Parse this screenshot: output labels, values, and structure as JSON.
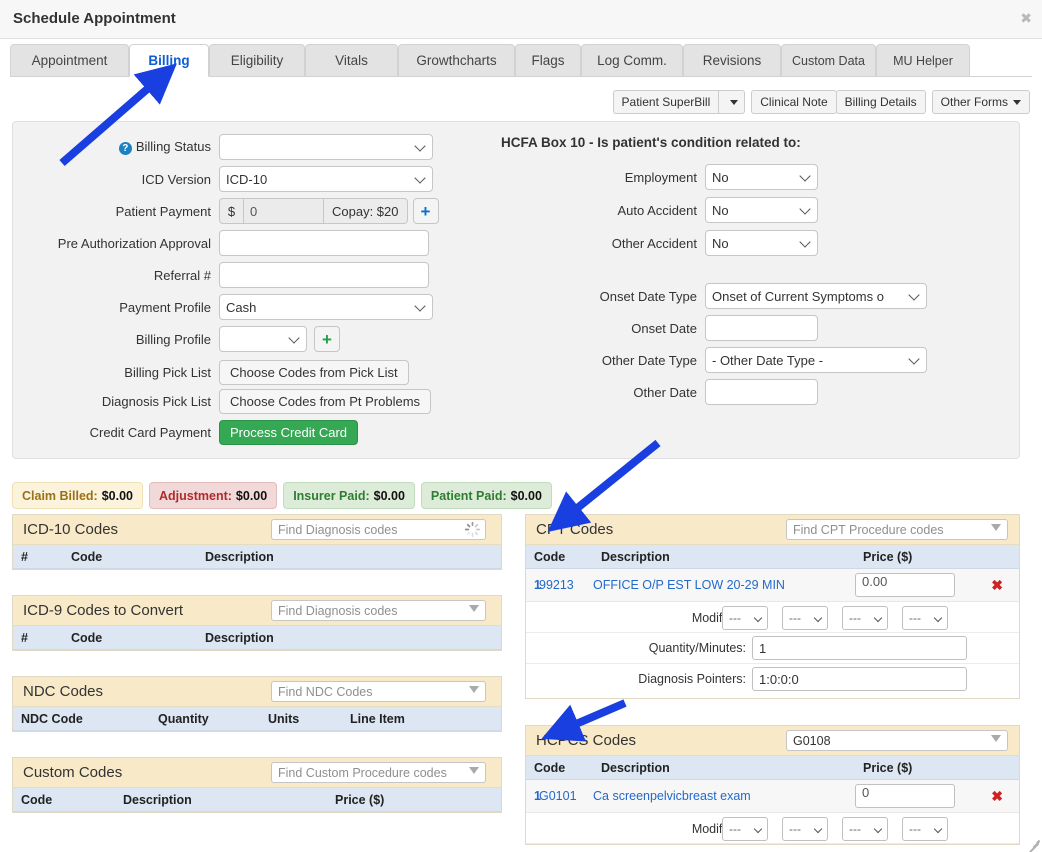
{
  "window": {
    "title": "Schedule Appointment",
    "close_label": "✖"
  },
  "tabs": [
    {
      "label": "Appointment",
      "active": false
    },
    {
      "label": "Billing",
      "active": true
    },
    {
      "label": "Eligibility",
      "active": false
    },
    {
      "label": "Vitals",
      "active": false
    },
    {
      "label": "Growthcharts",
      "active": false
    },
    {
      "label": "Flags",
      "active": false
    },
    {
      "label": "Log Comm.",
      "active": false
    },
    {
      "label": "Revisions",
      "active": false
    },
    {
      "label": "Custom Data",
      "active": false
    },
    {
      "label": "MU Helper",
      "active": false
    }
  ],
  "form_buttons": {
    "patient_superbill": "Patient SuperBill",
    "superbill_caret": "▼",
    "clinical_note": "Clinical Note",
    "billing_details": "Billing Details",
    "other_forms": "Other Forms"
  },
  "billing_form": {
    "help_icon_char": "?",
    "billing_status_label": "Billing Status",
    "billing_status_value": "",
    "icd_version_label": "ICD Version",
    "icd_version_value": "ICD-10",
    "patient_payment_label": "Patient Payment",
    "patient_payment_currency": "$",
    "patient_payment_value": "0",
    "copay_label": "Copay: $20",
    "add_payment_icon": "+",
    "pre_auth_label": "Pre Authorization Approval",
    "pre_auth_value": "",
    "referral_label": "Referral #",
    "referral_value": "",
    "payment_profile_label": "Payment Profile",
    "payment_profile_value": "Cash",
    "billing_profile_label": "Billing Profile",
    "billing_profile_value": "",
    "billing_profile_add_icon": "+",
    "billing_pick_list_label": "Billing Pick List",
    "billing_pick_list_button": "Choose Codes from Pick List",
    "diagnosis_pick_list_label": "Diagnosis Pick List",
    "diagnosis_pick_list_button": "Choose Codes from Pt Problems",
    "credit_card_label": "Credit Card Payment",
    "credit_card_button": "Process Credit Card"
  },
  "hcfa": {
    "title": "HCFA Box 10 - Is patient's condition related to:",
    "employment_label": "Employment",
    "employment_value": "No",
    "auto_accident_label": "Auto Accident",
    "auto_accident_value": "No",
    "other_accident_label": "Other Accident",
    "other_accident_value": "No",
    "onset_date_type_label": "Onset Date Type",
    "onset_date_type_value": "Onset of Current Symptoms o",
    "onset_date_label": "Onset Date",
    "onset_date_value": "",
    "other_date_type_label": "Other Date Type",
    "other_date_type_value": "- Other Date Type -",
    "other_date_label": "Other Date",
    "other_date_value": ""
  },
  "badges": [
    {
      "label": "Claim Billed:",
      "amount": "$0.00",
      "bg": "#fcf3dd",
      "border": "#f0e0b4",
      "fg": "#9a7116"
    },
    {
      "label": "Adjustment:",
      "amount": "$0.00",
      "bg": "#f2d9d9",
      "border": "#e4bcbc",
      "fg": "#b02b2b"
    },
    {
      "label": "Insurer Paid:",
      "amount": "$0.00",
      "bg": "#dcecd9",
      "border": "#c2dcbe",
      "fg": "#2f7d33"
    },
    {
      "label": "Patient Paid:",
      "amount": "$0.00",
      "bg": "#dcecd9",
      "border": "#c2dcbe",
      "fg": "#2f7d33"
    }
  ],
  "panels": {
    "icd10": {
      "title": "ICD-10 Codes",
      "search_placeholder": "Find Diagnosis codes",
      "columns": [
        "#",
        "Code",
        "Description"
      ],
      "rows": []
    },
    "icd9": {
      "title": "ICD-9 Codes to Convert",
      "search_placeholder": "Find Diagnosis codes",
      "columns": [
        "#",
        "Code",
        "Description"
      ],
      "rows": []
    },
    "ndc": {
      "title": "NDC Codes",
      "search_placeholder": "Find NDC Codes",
      "columns": [
        "NDC Code",
        "Quantity",
        "Units",
        "Line Item"
      ],
      "rows": []
    },
    "custom": {
      "title": "Custom Codes",
      "search_placeholder": "Find Custom Procedure codes",
      "columns": [
        "Code",
        "Description",
        "Price ($)"
      ],
      "rows": []
    },
    "cpt": {
      "title": "CPT Codes",
      "search_placeholder": "Find CPT Procedure codes",
      "columns": [
        "Code",
        "Description",
        "Price ($)"
      ],
      "row": {
        "index": "1",
        "code": "99213",
        "description": "OFFICE O/P EST LOW 20-29 MIN",
        "price": "0.00",
        "delete_icon": "✖"
      },
      "modifiers_label": "Modifiers:",
      "modifier_values": [
        "---",
        "---",
        "---",
        "---"
      ],
      "quantity_label": "Quantity/Minutes:",
      "quantity_value": "1",
      "pointers_label": "Diagnosis Pointers:",
      "pointers_value": "1:0:0:0"
    },
    "hcpcs": {
      "title": "HCPCS Codes",
      "search_value": "G0108",
      "columns": [
        "Code",
        "Description",
        "Price ($)"
      ],
      "row": {
        "index": "1",
        "code": "G0101",
        "description": "Ca screenpelvicbreast exam",
        "price": "0",
        "delete_icon": "✖"
      },
      "modifiers_label": "Modifiers:",
      "modifier_values": [
        "---",
        "---",
        "---",
        "---"
      ]
    }
  },
  "annotation": {
    "arrow_color": "#1a3fe0"
  }
}
